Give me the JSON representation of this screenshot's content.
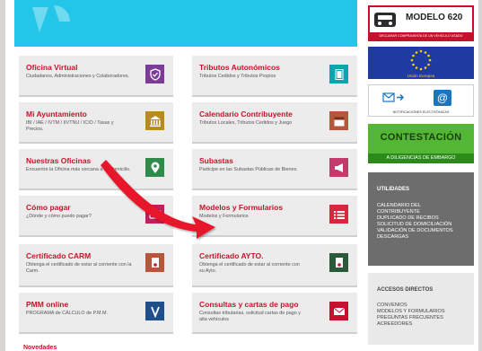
{
  "cards": [
    {
      "title": "Oficina Virtual",
      "desc": "Ciudadanos, Administraciones y Colaboradores.",
      "icon": "shield-check-icon",
      "color": "#7b3b97"
    },
    {
      "title": "Tributos Autonómicos",
      "desc": "Tributos Cedidos y Tributos Propios",
      "icon": "book-icon",
      "color": "#0aa6b0"
    },
    {
      "title": "Mi Ayuntamiento",
      "desc": "IBI / IAE / IVTM / IIVTNU / ICIO / Tasas y Precios.",
      "icon": "town-hall-icon",
      "color": "#b98a1e"
    },
    {
      "title": "Calendario Contribuyente",
      "desc": "Tributos Locales, Tributos Cedidos y Juego",
      "icon": "calendar-icon",
      "color": "#b5573a"
    },
    {
      "title": "Nuestras Oficinas",
      "desc": "Encuentre la Oficina más cercana a su domicilio.",
      "icon": "map-pin-icon",
      "color": "#2e8b4a"
    },
    {
      "title": "Subastas",
      "desc": "Participe en las Subastas Públicas de Bienes.",
      "icon": "megaphone-icon",
      "color": "#c23b6b"
    },
    {
      "title": "Cómo pagar",
      "desc": "¿Dónde y cómo puedo pagar?",
      "icon": "credit-card-icon",
      "color": "#c21f5b"
    },
    {
      "title": "Modelos y Formularios",
      "desc": "Modelos y Formularios",
      "icon": "list-icon",
      "color": "#d7263d"
    },
    {
      "title": "Certificado CARM",
      "desc": "Obtenga el certificado de estar al corriente con la Carm.",
      "icon": "certificate-icon",
      "color": "#b5573a"
    },
    {
      "title": "Certificado AYTO.",
      "desc": "Obtenga el certificado de estar al corriente con su Ayto.",
      "icon": "certificate-icon",
      "color": "#2a5a3a"
    },
    {
      "title": "PMM online",
      "desc": "PROGRAMA de CÁLCULO de P.M.M.",
      "icon": "v-logo-icon",
      "color": "#1f4f8b"
    },
    {
      "title": "Consultas y cartas de pago",
      "desc": "Consultas tributarias, solicitud cartas de pago y alta vehículos",
      "icon": "envelope-icon",
      "color": "#c8102e"
    }
  ],
  "sidebar": {
    "modelo": {
      "title": "MODELO 620",
      "subtitle": "DECLARAR COMPRAVENTA DE UN VEHÍCULO USADO"
    },
    "eu": {
      "label": "Unión Europea"
    },
    "notif": {
      "label": "NOTIFICACIONES ELECTRÓNICAS"
    },
    "contestacion": {
      "title": "CONTESTACIÓN",
      "subtitle": "A DILIGENCIAS DE EMBARGO"
    },
    "utilidades": {
      "title": "UTILIDADES",
      "items": [
        "CALENDARIO DEL",
        "CONTRIBUYENTE",
        "DUPLICADO DE RECIBOS",
        "SOLICITUD DE DOMICILIACIÓN",
        "VALIDACIÓN DE DOCUMENTOS",
        "DESCARGAS"
      ]
    },
    "accesos": {
      "title": "ACCESOS DIRECTOS",
      "items": [
        "CONVENIOS",
        "MODELOS Y FORMULARIOS",
        "PREGUNTAS FRECUENTES",
        "ACREEDORES"
      ]
    }
  },
  "footer": {
    "label": "Novedades"
  },
  "colors": {
    "accent": "#c5142a",
    "hero": "#23c6e8",
    "arrow": "#e8192c"
  }
}
